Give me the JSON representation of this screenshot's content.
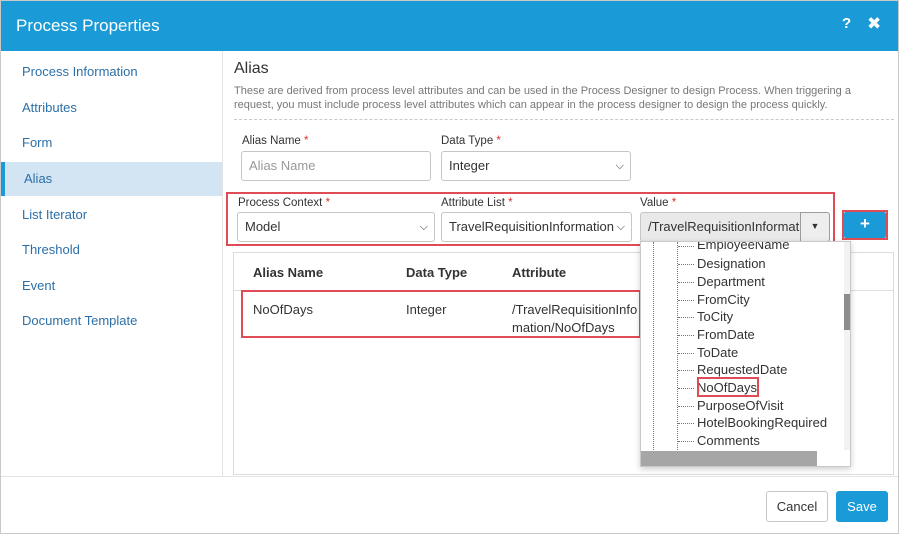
{
  "dialog": {
    "title": "Process Properties",
    "help_glyph": "?",
    "close_glyph": "✖"
  },
  "sidebar": {
    "items": [
      {
        "label": "Process Information"
      },
      {
        "label": "Attributes"
      },
      {
        "label": "Form"
      },
      {
        "label": "Alias",
        "active": true
      },
      {
        "label": "List Iterator"
      },
      {
        "label": "Threshold"
      },
      {
        "label": "Event"
      },
      {
        "label": "Document Template"
      }
    ]
  },
  "alias": {
    "title": "Alias",
    "description": "These are derived from process level attributes and can be used in the Process Designer to design Process. When triggering a request, you must include process level attributes which can appear in the process designer to design the process quickly."
  },
  "form": {
    "alias_name_label": "Alias Name",
    "alias_name_placeholder": "Alias Name",
    "data_type_label": "Data Type",
    "data_type_value": "Integer",
    "process_context_label": "Process Context",
    "process_context_value": "Model",
    "attribute_list_label": "Attribute List",
    "attribute_list_value": "TravelRequisitionInformation",
    "value_label": "Value",
    "value_value": "/TravelRequisitionInformation",
    "required_mark": "*",
    "add_glyph": "+"
  },
  "grid": {
    "headers": [
      "Alias Name",
      "Data Type",
      "Attribute"
    ],
    "rows": [
      {
        "alias_name": "NoOfDays",
        "data_type": "Integer",
        "attribute_line1": "/TravelRequisitionInfo",
        "attribute_line2": "mation/NoOfDays"
      }
    ]
  },
  "value_dropdown": {
    "items": [
      "EmployeeName",
      "Designation",
      "Department",
      "FromCity",
      "ToCity",
      "FromDate",
      "ToDate",
      "RequestedDate",
      "NoOfDays",
      "PurposeOfVisit",
      "HotelBookingRequired",
      "Comments"
    ],
    "highlighted": "NoOfDays"
  },
  "footer": {
    "cancel_label": "Cancel",
    "save_label": "Save"
  },
  "colors": {
    "accent": "#1a9ad6",
    "highlight_border": "#e04c55",
    "link": "#2c6fa8"
  }
}
